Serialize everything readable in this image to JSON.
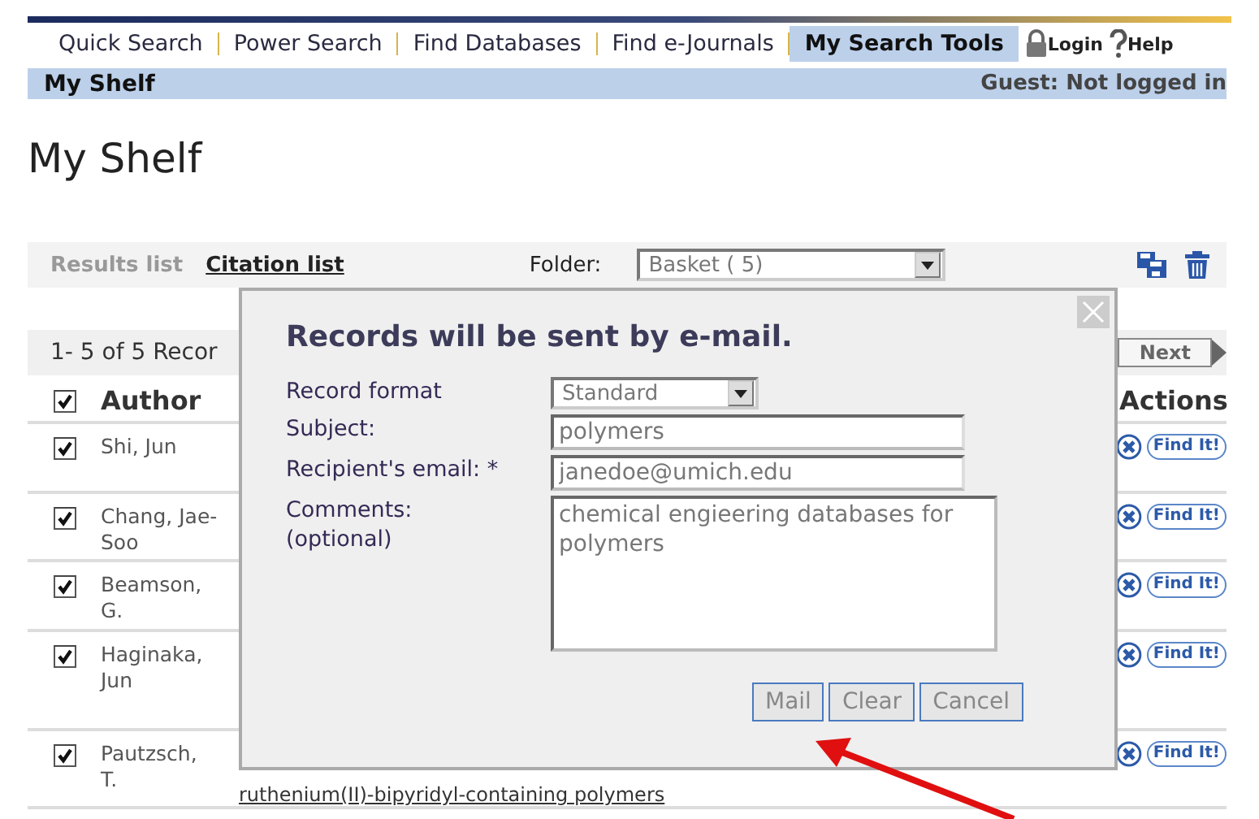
{
  "nav": {
    "items": [
      {
        "label": "Quick Search",
        "selected": false
      },
      {
        "label": "Power Search",
        "selected": false
      },
      {
        "label": "Find Databases",
        "selected": false
      },
      {
        "label": "Find e-Journals",
        "selected": false
      },
      {
        "label": "My Search Tools",
        "selected": true
      }
    ],
    "login": "Login",
    "help": "Help"
  },
  "subnav": {
    "title": "My Shelf",
    "status": "Guest: Not logged in"
  },
  "heading": "My Shelf",
  "toolbar": {
    "views": [
      {
        "label": "Results list",
        "selected": false
      },
      {
        "label": "Citation list",
        "selected": true
      }
    ],
    "folder_label": "Folder:",
    "folder": "Basket ( 5)"
  },
  "results": {
    "count": "1- 5 of 5 Recor",
    "next": "Next"
  },
  "table": {
    "select_all_checked": true,
    "author_heading": "Author",
    "actions_heading": "Actions",
    "rows": [
      {
        "author": "Shi, Jun",
        "checked": true,
        "find_label": "Find It!"
      },
      {
        "author": "Chang, Jae-Soo",
        "checked": true,
        "find_label": "Find It!"
      },
      {
        "author": "Beamson, G.",
        "checked": true,
        "find_label": "Find It!"
      },
      {
        "author": "Haginaka, Jun",
        "checked": true,
        "find_label": "Find It!"
      },
      {
        "author": "Pautzsch, T.",
        "checked": true,
        "find_label": "Find It!",
        "title": "ruthenium(II)-bipyridyl-containing polymers"
      }
    ]
  },
  "dialog": {
    "title": "Records will be sent by e-mail.",
    "format_label": "Record format",
    "format": "Standard",
    "subject_label": "Subject:",
    "subject": "polymers",
    "email_label": "Recipient's email: *",
    "email": "janedoe@umich.edu",
    "comments_label": "Comments:",
    "comments_hint": "(optional)",
    "comments": "chemical engieering databases for polymers",
    "buttons": [
      "Mail",
      "Clear",
      "Cancel"
    ]
  }
}
